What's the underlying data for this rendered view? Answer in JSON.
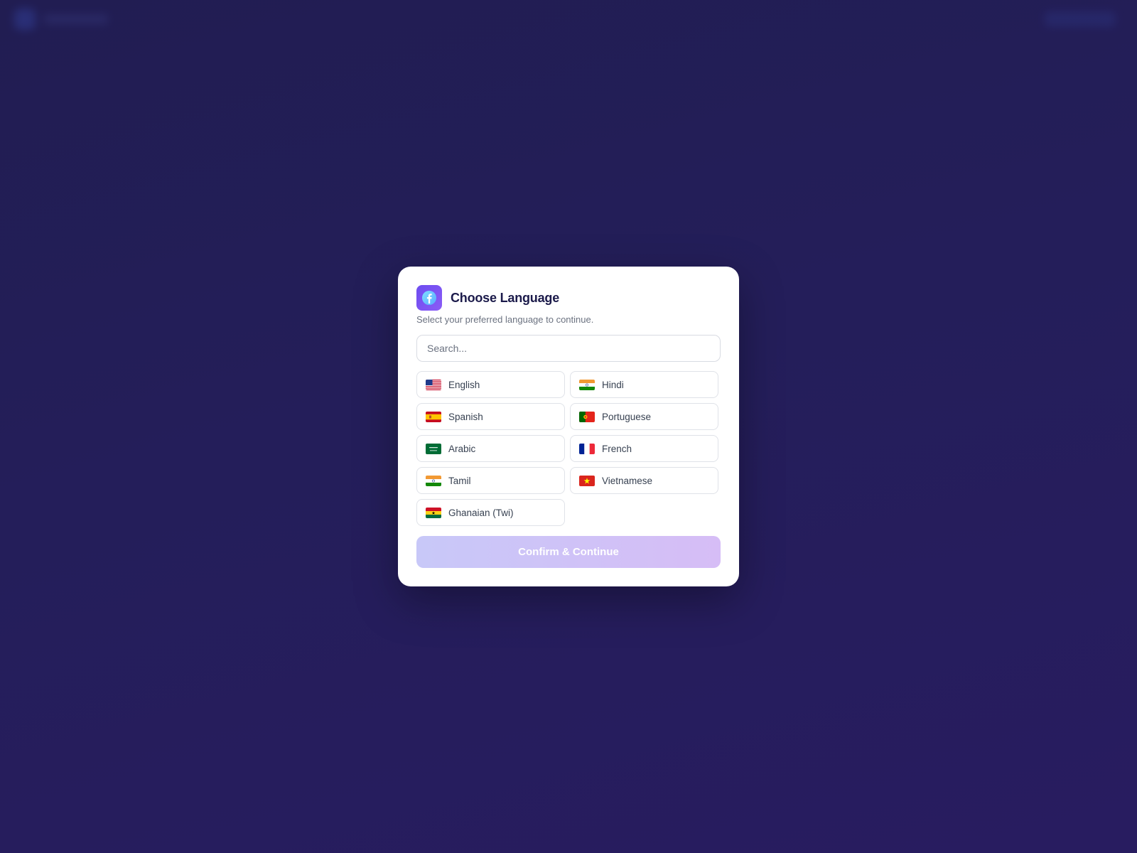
{
  "background": {
    "colors": {
      "top": "#211d52",
      "bottom": "#281c60"
    }
  },
  "modal": {
    "icon": "facebook-icon",
    "title": "Choose Language",
    "subtitle": "Select your preferred language to continue.",
    "search": {
      "placeholder": "Search...",
      "value": ""
    },
    "languages": [
      {
        "label": "English",
        "flag": "us-flag-icon"
      },
      {
        "label": "Hindi",
        "flag": "india-flag-icon"
      },
      {
        "label": "Spanish",
        "flag": "spain-flag-icon"
      },
      {
        "label": "Portuguese",
        "flag": "portugal-flag-icon"
      },
      {
        "label": "Arabic",
        "flag": "saudi-arabia-flag-icon"
      },
      {
        "label": "French",
        "flag": "france-flag-icon"
      },
      {
        "label": "Tamil",
        "flag": "india-flag-icon"
      },
      {
        "label": "Vietnamese",
        "flag": "vietnam-flag-icon"
      },
      {
        "label": "Ghanaian (Twi)",
        "flag": "ghana-flag-icon"
      }
    ],
    "confirm_label": "Confirm & Continue",
    "colors": {
      "title": "#1b1a4a",
      "accent": "#6d4cf0",
      "confirm_start": "#c8c8f8",
      "confirm_end": "#d6bdf6"
    }
  }
}
